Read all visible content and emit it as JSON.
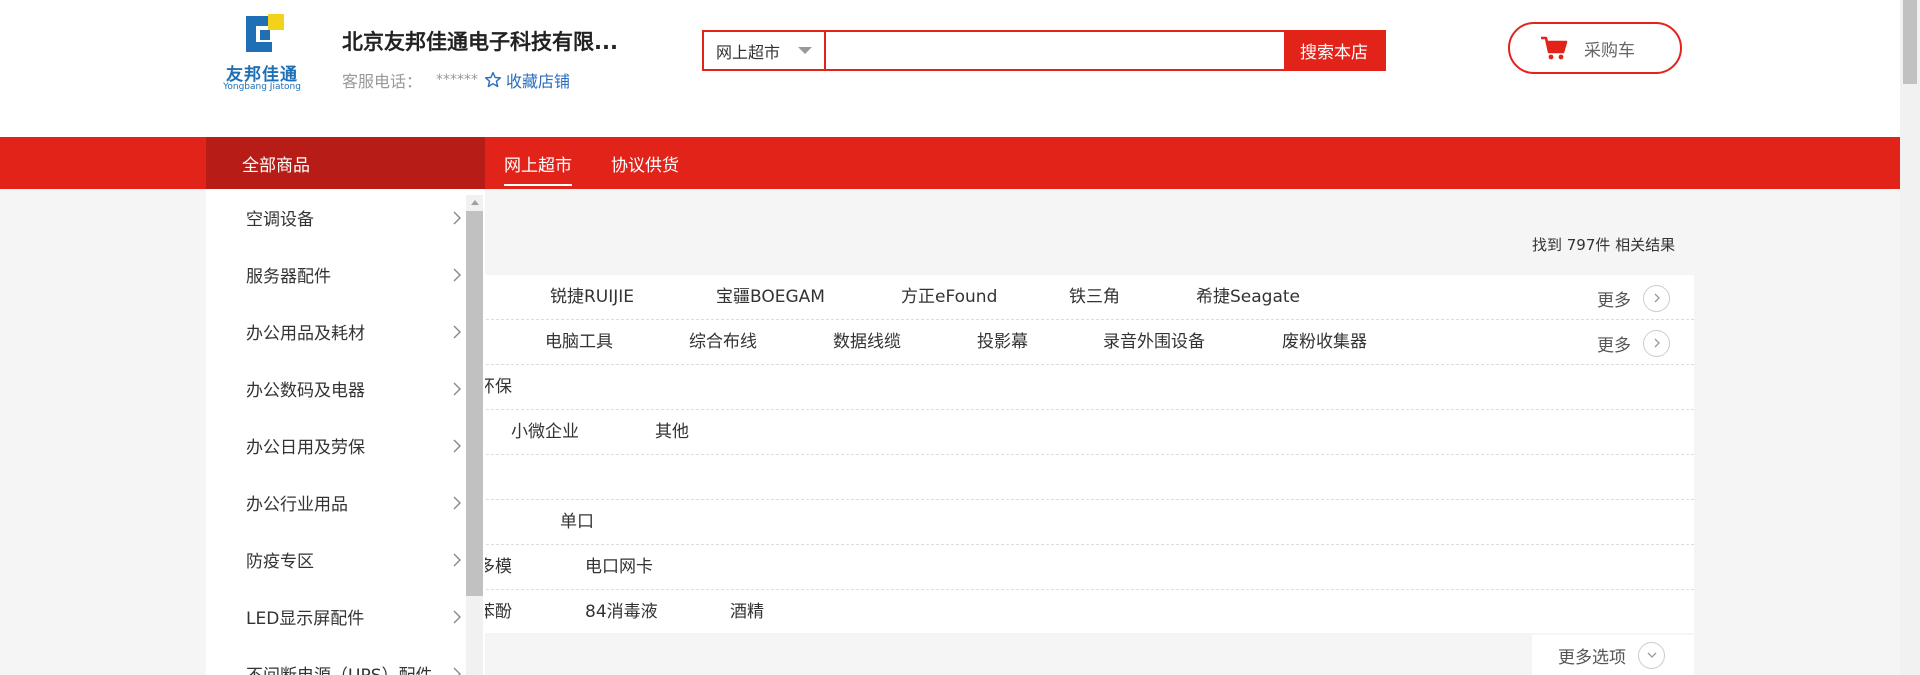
{
  "header": {
    "logo_cn": "友邦佳通",
    "logo_en": "Yongbang Jiatong",
    "shop_name": "北京友邦佳通电子科技有限...",
    "service_label": "客服电话：",
    "service_value": "******",
    "favorite_label": "收藏店铺"
  },
  "search": {
    "scope_value": "网上超市",
    "placeholder": "",
    "button_label": "搜索本店"
  },
  "cart": {
    "label": "采购车"
  },
  "nav": {
    "all_goods": "全部商品",
    "tabs": [
      {
        "label": "网上超市",
        "active": true
      },
      {
        "label": "协议供货",
        "active": false
      }
    ]
  },
  "categories": [
    "空调设备",
    "服务器配件",
    "办公用品及耗材",
    "办公数码及电器",
    "办公日用及劳保",
    "办公行业用品",
    "防疫专区",
    "LED显示屏配件",
    "不间断电源（UPS）配件"
  ],
  "results": {
    "count_text": "找到 797件 相关结果",
    "more_label": "更多",
    "more_options_label": "更多选项"
  },
  "filter_rows": [
    {
      "items": [
        "锐捷RUIJIE",
        "宝疆BOEGAM",
        "方正eFound",
        "铁三角",
        "希捷Seagate"
      ],
      "has_more": true
    },
    {
      "items": [
        "电脑工具",
        "综合布线",
        "数据线缆",
        "投影幕",
        "录音外围设备",
        "废粉收集器"
      ],
      "has_more": true
    },
    {
      "items": [
        "环保"
      ],
      "has_more": false
    },
    {
      "items": [
        "小微企业",
        "其他"
      ],
      "has_more": false
    },
    {
      "items": [],
      "has_more": false
    },
    {
      "items": [
        "单口"
      ],
      "has_more": false
    },
    {
      "items": [
        "多模",
        "电口网卡"
      ],
      "has_more": false
    },
    {
      "items": [
        "苯酚",
        "84消毒液",
        "酒精"
      ],
      "has_more": false
    }
  ],
  "colors": {
    "brand_red": "#e2231a",
    "dark_red": "#b81c16",
    "link_blue": "#2a6ebb",
    "logo_blue": "#1f6fb5",
    "logo_yellow": "#f2d21b"
  }
}
